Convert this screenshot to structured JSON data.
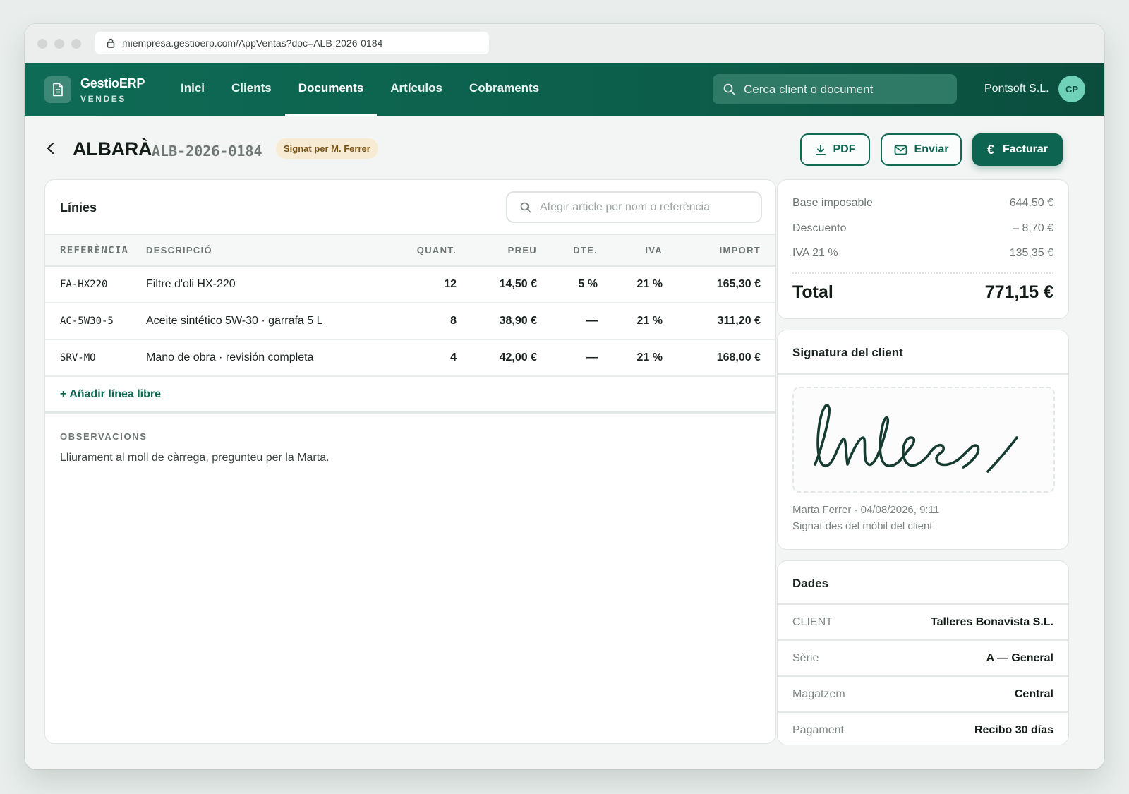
{
  "browser": {
    "url": "miempresa.gestioerp.com/AppVentas?doc=ALB-2026-0184"
  },
  "nav": {
    "brand": "GestioERP",
    "brand_sub": "VENDES",
    "links": [
      "Inici",
      "Clients",
      "Documents",
      "Artículos",
      "Cobraments"
    ],
    "active": "Documents",
    "search_placeholder": "Cerca client o document",
    "company": "Pontsoft S.L.",
    "avatar_initials": "CP"
  },
  "header": {
    "doc_type": "ALBARÀ",
    "doc_number": "ALB-2026-0184",
    "badge": "Signat per M. Ferrer",
    "buttons": {
      "pdf": "PDF",
      "send": "Enviar",
      "invoice": "Facturar"
    }
  },
  "lines": {
    "title": "Línies",
    "add_placeholder": "Afegir article per nom o referència",
    "columns": [
      "REFERÈNCIA",
      "DESCRIPCIÓ",
      "QUANT.",
      "PREU",
      "DTE.",
      "IVA",
      "IMPORT"
    ],
    "rows": [
      {
        "ref": "FA-HX220",
        "desc": "Filtre d'oli HX-220",
        "qty": "12",
        "price": "14,50 €",
        "dte": "5 %",
        "iva": "21 %",
        "amount": "165,30 €"
      },
      {
        "ref": "AC-5W30-5",
        "desc": "Aceite sintético 5W-30 · garrafa 5 L",
        "qty": "8",
        "price": "38,90 €",
        "dte": "—",
        "iva": "21 %",
        "amount": "311,20 €"
      },
      {
        "ref": "SRV-MO",
        "desc": "Mano de obra · revisión completa",
        "qty": "4",
        "price": "42,00 €",
        "dte": "—",
        "iva": "21 %",
        "amount": "168,00 €"
      }
    ],
    "add_line": "+ Añadir línea libre",
    "observations_label": "OBSERVACIONS",
    "observations": "Lliurament al moll de càrrega, pregunteu per la Marta."
  },
  "totals": {
    "base_label": "Base imposable",
    "base": "644,50 €",
    "discount_label": "Descuento",
    "discount": "– 8,70 €",
    "iva_label": "IVA 21 %",
    "iva": "135,35 €",
    "total_label": "Total",
    "total": "771,15 €"
  },
  "signature": {
    "title": "Signatura del client",
    "meta_line1": "Marta Ferrer · 04/08/2026, 9:11",
    "meta_line2": "Signat des del mòbil del client"
  },
  "data": {
    "title": "Dades",
    "rows": [
      {
        "k": "CLIENT",
        "v": "Talleres Bonavista S.L."
      },
      {
        "k": "Sèrie",
        "v": "A — General"
      },
      {
        "k": "Magatzem",
        "v": "Central"
      },
      {
        "k": "Pagament",
        "v": "Recibo 30 días"
      }
    ]
  },
  "colors": {
    "brand": "#0e6b55",
    "accent": "#0d6450",
    "badge_bg": "#f7ecd3",
    "badge_text": "#7a5415"
  }
}
